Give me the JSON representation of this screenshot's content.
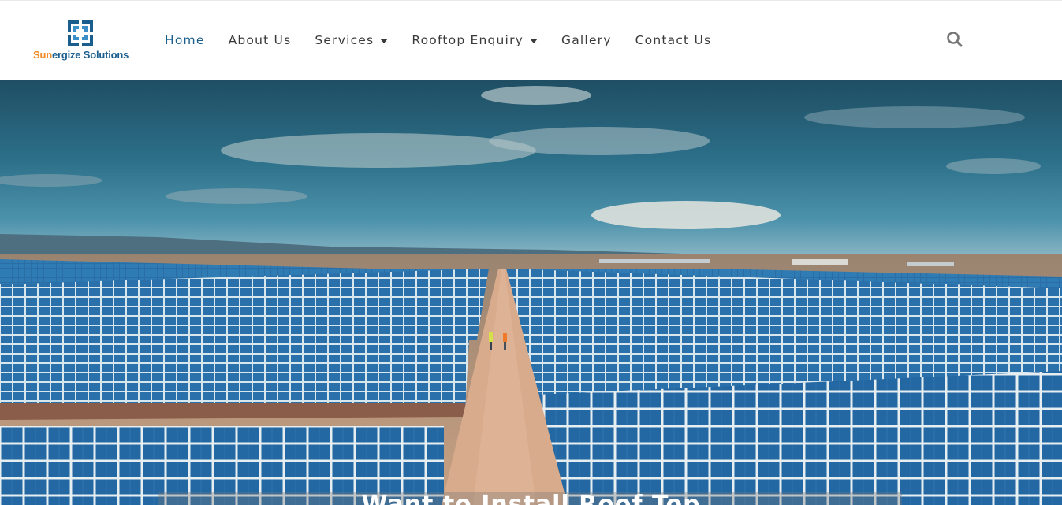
{
  "brand": {
    "name_highlight": "Sun",
    "name_rest": "ergize Solutions",
    "logo_icon": "square-frame-logo-icon",
    "highlight_color": "#f08a24",
    "primary_color": "#1a5e8e"
  },
  "nav": {
    "items": [
      {
        "label": "Home",
        "active": true,
        "dropdown": false
      },
      {
        "label": "About Us",
        "active": false,
        "dropdown": false
      },
      {
        "label": "Services",
        "active": false,
        "dropdown": true
      },
      {
        "label": "Rooftop Enquiry",
        "active": false,
        "dropdown": true
      },
      {
        "label": "Gallery",
        "active": false,
        "dropdown": false
      },
      {
        "label": "Contact Us",
        "active": false,
        "dropdown": false
      }
    ],
    "search_icon": "search-icon"
  },
  "hero": {
    "caption": "Want to Install Roof Top",
    "image": "solar-farm-photo"
  }
}
